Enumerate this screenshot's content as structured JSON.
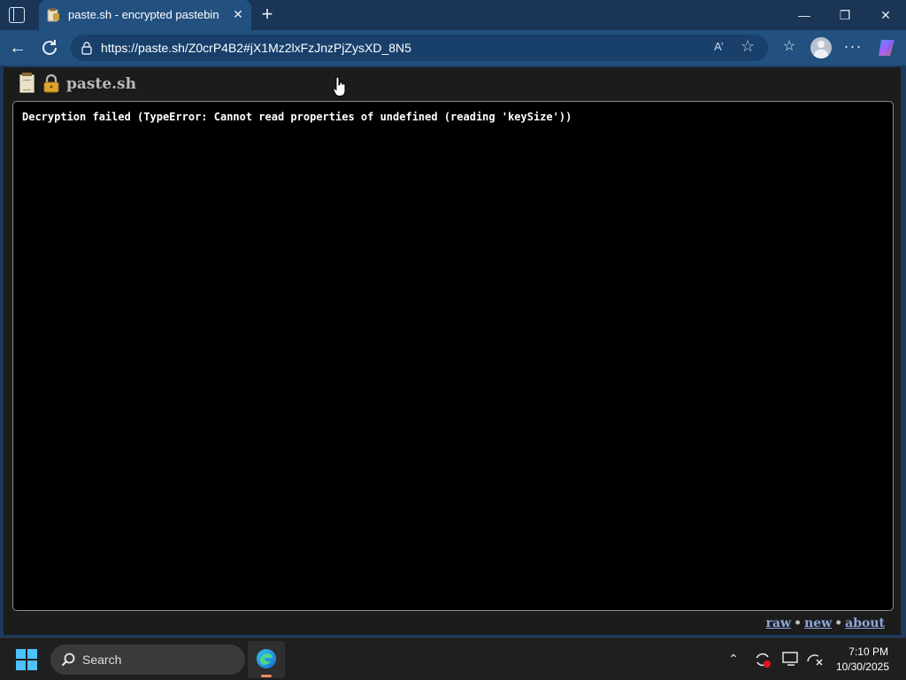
{
  "browser": {
    "tab": {
      "title": "paste.sh - encrypted pastebin"
    },
    "address_bar": {
      "url": "https://paste.sh/Z0crP4B2#jX1Mz2lxFzJnzPjZysXD_8N5"
    },
    "read_aloud_label": "A’"
  },
  "page": {
    "site_title": "paste.sh",
    "paste_content": "Decryption failed (TypeError: Cannot read properties of undefined (reading 'keySize'))",
    "footer": {
      "links": [
        "raw",
        "new",
        "about"
      ],
      "separator": "•"
    }
  },
  "taskbar": {
    "search_label": "Search",
    "clock": {
      "time": "7:10 PM",
      "date": "10/30/2025"
    }
  },
  "colors": {
    "titlebar": "#1b3556",
    "toolbar": "#22507f",
    "page_background": "#1c1c1c",
    "paste_background": "#000000",
    "link": "#8fa7dc",
    "taskbar": "#1f1f1f"
  }
}
